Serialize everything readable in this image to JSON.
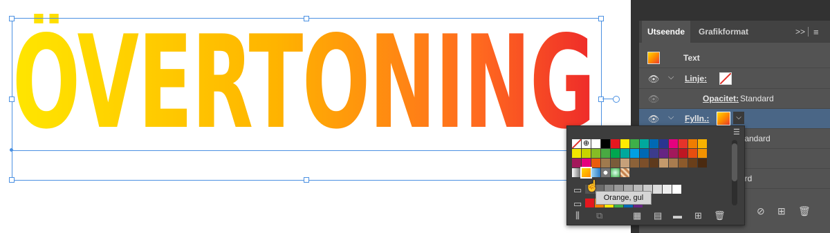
{
  "canvas": {
    "art_text": "ÖVERTONING"
  },
  "panel": {
    "tabs": [
      "Utseende",
      "Grafikformat"
    ],
    "tab_controls": ">>",
    "rows": {
      "text": "Text",
      "stroke": "Linje:",
      "opacity_label": "Opacitet:",
      "opacity_value": "Standard",
      "fill": "Fylln.:",
      "fill_opacity": "Standard",
      "extra_value": "ard"
    }
  },
  "swatches": {
    "row1": [
      "#ffffff",
      "#000000",
      "#e5171f",
      "#f6a01a",
      "#ffea00",
      "#3eb049",
      "#008c45",
      "#00a99d",
      "#2a3590",
      "#9b1c84",
      "#e6007e",
      "#e6332a",
      "#ef7d00",
      "#f9b200"
    ],
    "row2": [
      "#f2e500",
      "#c8d400",
      "#86bc25",
      "#49a942",
      "#00a64f",
      "#00a99d",
      "#009fe3",
      "#0069b4",
      "#3c3c8c",
      "#662483",
      "#a3195b",
      "#be1622",
      "#e84e0f",
      "#f39200"
    ],
    "row3": [
      "#a2195b",
      "#e6007e",
      "#ea5b0c",
      "#a07a4e",
      "#7a5c3a",
      "#c6a07a",
      "#8c6239",
      "#7c4f2a",
      "#5e3a1d",
      "#c49a6c",
      "#a87c4f",
      "#8c5a2b",
      "#6a3f1a",
      "#4a2a10"
    ],
    "row4": [
      "#cccccc",
      "#f39200",
      "#4db3e6",
      "#ffffff",
      "#3eb049",
      "#c58450"
    ],
    "grays": [
      "#333333",
      "#555555",
      "#777777",
      "#999999",
      "#aaaaaa",
      "#bbbbbb",
      "#cccccc",
      "#dddddd",
      "#eeeeee",
      "#ffffff"
    ],
    "row5": [
      "#e5171f",
      "#ef7d00",
      "#ffea00",
      "#3eb049",
      "#0069b4",
      "#662483"
    ]
  },
  "tooltip": "Orange, gul"
}
